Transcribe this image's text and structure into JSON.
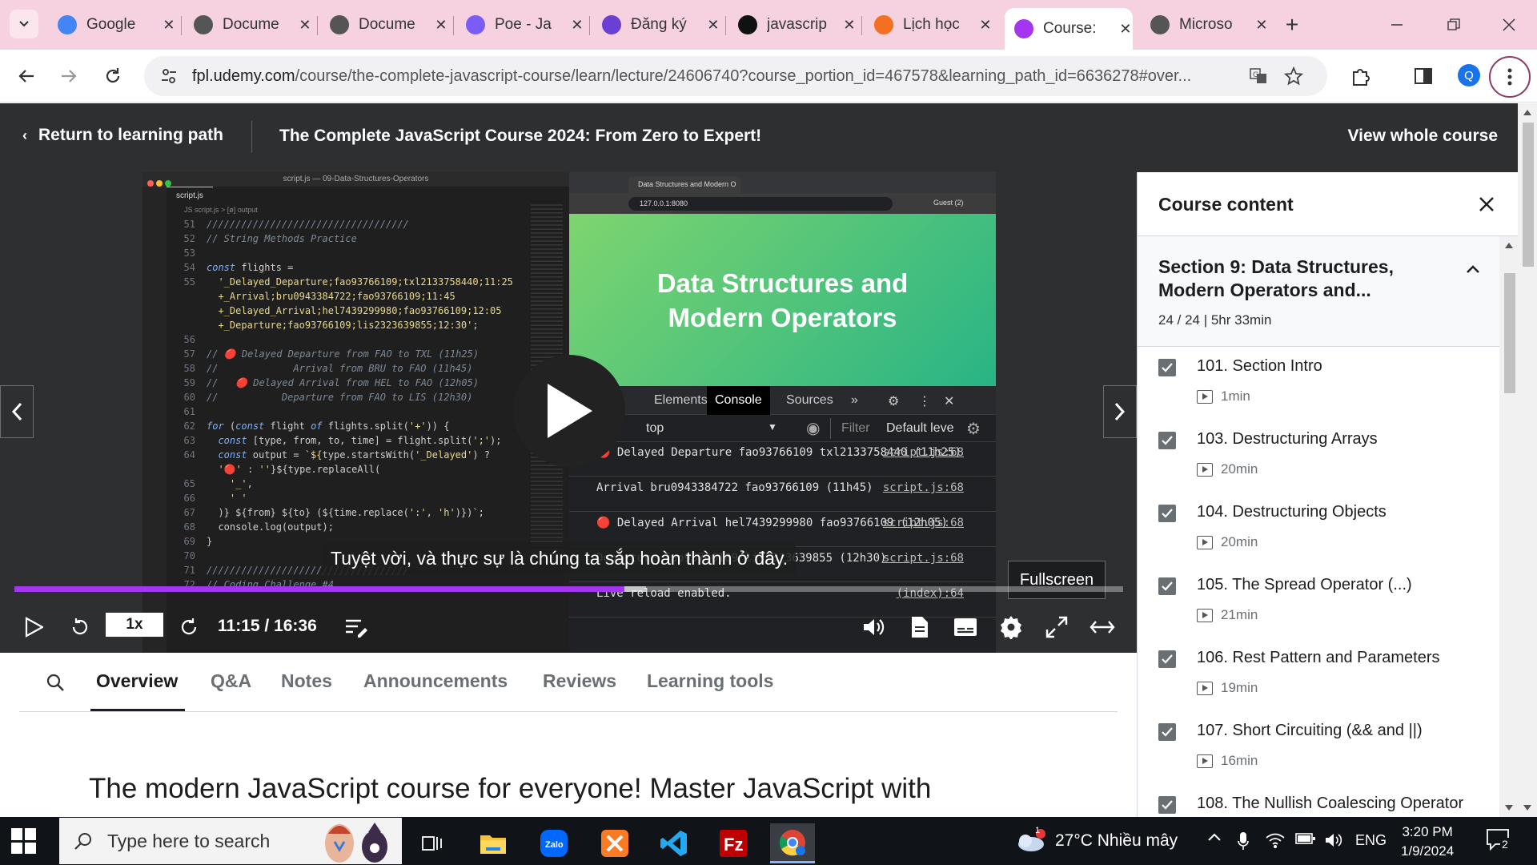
{
  "browser": {
    "tabs": [
      {
        "title": "Google",
        "favicon": "google-translate-icon",
        "color": "#4285f4"
      },
      {
        "title": "Docume",
        "favicon": "globe-icon",
        "color": "#555555"
      },
      {
        "title": "Docume",
        "favicon": "globe-icon",
        "color": "#555555"
      },
      {
        "title": "Poe - Ja",
        "favicon": "poe-icon",
        "color": "#7b5cf5"
      },
      {
        "title": "Đăng ký",
        "favicon": "form-icon",
        "color": "#6a3fd6"
      },
      {
        "title": "javascrip",
        "favicon": "github-icon",
        "color": "#111111"
      },
      {
        "title": "Lịch học",
        "favicon": "fpt-icon",
        "color": "#f36f21"
      },
      {
        "title": "Course:",
        "favicon": "udemy-icon",
        "color": "#a435f0"
      },
      {
        "title": "Microso",
        "favicon": "globe-icon",
        "color": "#555555"
      }
    ],
    "active_tab_index": 7,
    "url_host": "fpl.udemy.com",
    "url_path": "/course/the-complete-javascript-course/learn/lecture/24606740?course_portion_id=467578&learning_path_id=6636278#over...",
    "profile_initial": "Q"
  },
  "header": {
    "back_label": "Return to learning path",
    "course_title": "The Complete JavaScript Course 2024: From Zero to Expert!",
    "view_whole": "View whole course"
  },
  "video": {
    "editor_title": "script.js — 09-Data-Structures-Operators",
    "editor_tab": "script.js",
    "editor_breadcrumb": "JS script.js > [ø] output",
    "code_lines": [
      {
        "n": "51",
        "html": "<span class='cm'>///////////////////////////////////</span>"
      },
      {
        "n": "52",
        "html": "<span class='cm'>// String Methods Practice</span>"
      },
      {
        "n": "53",
        "html": ""
      },
      {
        "n": "54",
        "html": "<span class='kw'>const</span> flights ="
      },
      {
        "n": "55",
        "html": "  <span class='st'>'_Delayed_Departure;fao93766109;txl2133758440;11:25</span>"
      },
      {
        "n": "",
        "html": "  <span class='st'>+_Arrival;bru0943384722;fao93766109;11:45</span>"
      },
      {
        "n": "",
        "html": "  <span class='st'>+_Delayed_Arrival;hel7439299980;fao93766109;12:05</span>"
      },
      {
        "n": "",
        "html": "  <span class='st'>+_Departure;fao93766109;lis2323639855;12:30'</span>;"
      },
      {
        "n": "56",
        "html": ""
      },
      {
        "n": "57",
        "html": "<span class='cm'>// 🔴 Delayed Departure from FAO to TXL (11h25)</span>"
      },
      {
        "n": "58",
        "html": "<span class='cm'>//             Arrival from BRU to FAO (11h45)</span>"
      },
      {
        "n": "59",
        "html": "<span class='cm'>//   🔴 Delayed Arrival from HEL to FAO (12h05)</span>"
      },
      {
        "n": "60",
        "html": "<span class='cm'>//           Departure from FAO to LIS (12h30)</span>"
      },
      {
        "n": "61",
        "html": ""
      },
      {
        "n": "62",
        "html": "<span class='kw'>for</span> (<span class='kw'>const</span> flight <span class='kw'>of</span> flights.split(<span class='st'>'+'</span>)) {"
      },
      {
        "n": "63",
        "html": "  <span class='kw'>const</span> [type, from, to, time] = flight.split(<span class='st'>';'</span>);"
      },
      {
        "n": "64",
        "html": "  <span class='kw'>const</span> output = <span class='st'>`${</span>type.startsWith(<span class='st'>'_Delayed'</span>) ?"
      },
      {
        "n": "",
        "html": "  <span class='st'>'🔴'</span> : <span class='st'>''</span>}${type.replaceAll("
      },
      {
        "n": "65",
        "html": "    <span class='st'>'_'</span>,"
      },
      {
        "n": "66",
        "html": "    <span class='st'>' '</span>"
      },
      {
        "n": "67",
        "html": "  )} ${from} ${to} (${time.replace(<span class='st'>':'</span>, <span class='st'>'h'</span>)})`;"
      },
      {
        "n": "68",
        "html": "  console.log(output);"
      },
      {
        "n": "69",
        "html": "}"
      },
      {
        "n": "70",
        "html": ""
      },
      {
        "n": "71",
        "html": "<span class='cm'>///////////////////////////////////</span>"
      },
      {
        "n": "72",
        "html": "<span class='cm'>// Coding Challenge #4</span>"
      }
    ],
    "browser_tab": "Data Structures and Modern O",
    "browser_url": "127.0.0.1:8080",
    "browser_guest": "Guest (2)",
    "slide_title": "Data Structures and Modern Operators",
    "devtools": {
      "tabs": [
        "Elements",
        "Console",
        "Sources",
        "»"
      ],
      "active": "Console",
      "context": "top",
      "filter_placeholder": "Filter",
      "levels": "Default leve",
      "logs": [
        {
          "text": "🔴 Delayed Departure fao93766109 txl2133758440 (11h25)",
          "src": "script.js:68"
        },
        {
          "text": "Arrival bru0943384722 fao93766109 (11h45)",
          "src": "script.js:68"
        },
        {
          "text": "🔴 Delayed Arrival hel7439299980 fao93766109 (12h05)",
          "src": "script.js:68"
        },
        {
          "text": "Departure fao93766109 lis2323639855 (12h30)",
          "src": "script.js:68"
        },
        {
          "text": "Live reload enabled.",
          "src": "(index):64"
        }
      ]
    },
    "subtitle": "Tuyệt vời, và thực sự là chúng ta sắp hoàn thành ở đây.",
    "tooltip": "Fullscreen",
    "speed": "1x",
    "timecode": "11:15 / 16:36",
    "progress": 0.55,
    "buffered": 0.57
  },
  "lower_tabs": {
    "items": [
      "Overview",
      "Q&A",
      "Notes",
      "Announcements",
      "Reviews",
      "Learning tools"
    ],
    "active": "Overview"
  },
  "overview_lead": "The modern JavaScript course for everyone! Master JavaScript with",
  "sidebar": {
    "title": "Course content",
    "section_title": "Section 9: Data Structures, Modern Operators and...",
    "section_meta": "24 / 24 | 5hr 33min",
    "lectures": [
      {
        "title": "101. Section Intro",
        "duration": "1min"
      },
      {
        "title": "103. Destructuring Arrays",
        "duration": "20min"
      },
      {
        "title": "104. Destructuring Objects",
        "duration": "20min"
      },
      {
        "title": "105. The Spread Operator (...)",
        "duration": "21min"
      },
      {
        "title": "106. Rest Pattern and Parameters",
        "duration": "19min"
      },
      {
        "title": "107. Short Circuiting (&& and ||)",
        "duration": "16min"
      },
      {
        "title": "108. The Nullish Coalescing Operator",
        "duration": ""
      }
    ]
  },
  "taskbar": {
    "search_placeholder": "Type here to search",
    "weather": "27°C  Nhiều mây",
    "weather_badge": "1",
    "lang": "ENG",
    "time": "3:20 PM",
    "date": "1/9/2024",
    "notif_count": "2",
    "apps": [
      "task-view-icon",
      "file-explorer-icon",
      "zalo-icon",
      "xampp-icon",
      "vscode-icon",
      "filezilla-icon",
      "chrome-icon"
    ]
  }
}
